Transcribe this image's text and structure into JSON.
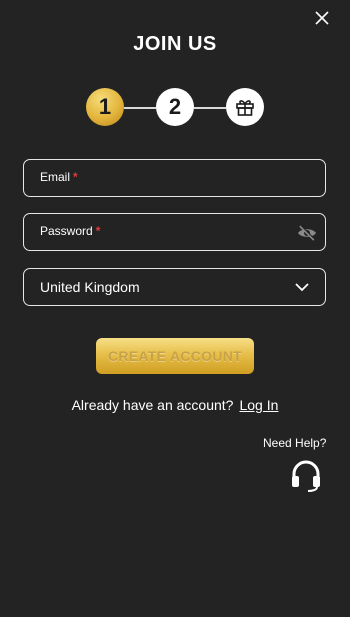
{
  "header": {
    "title": "JOIN US",
    "close_icon": "close-icon"
  },
  "steps": [
    {
      "label": "1",
      "state": "active",
      "color": "#e3b43b"
    },
    {
      "label": "2",
      "state": "pending"
    },
    {
      "icon": "gift-icon",
      "state": "pending"
    }
  ],
  "form": {
    "email": {
      "label": "Email",
      "required_mark": "*",
      "value": ""
    },
    "password": {
      "label": "Password",
      "required_mark": "*",
      "value": "",
      "toggle_icon": "eye-slash-icon"
    },
    "country": {
      "value": "United Kingdom",
      "icon": "chevron-down-icon"
    }
  },
  "actions": {
    "create_account": "CREATE ACCOUNT"
  },
  "login": {
    "prompt": "Already have an account?",
    "link": "Log In"
  },
  "help": {
    "label": "Need Help?",
    "icon": "headset-icon"
  },
  "colors": {
    "background": "#232323",
    "accent": "#e3b43b",
    "required": "#e23b3b"
  }
}
